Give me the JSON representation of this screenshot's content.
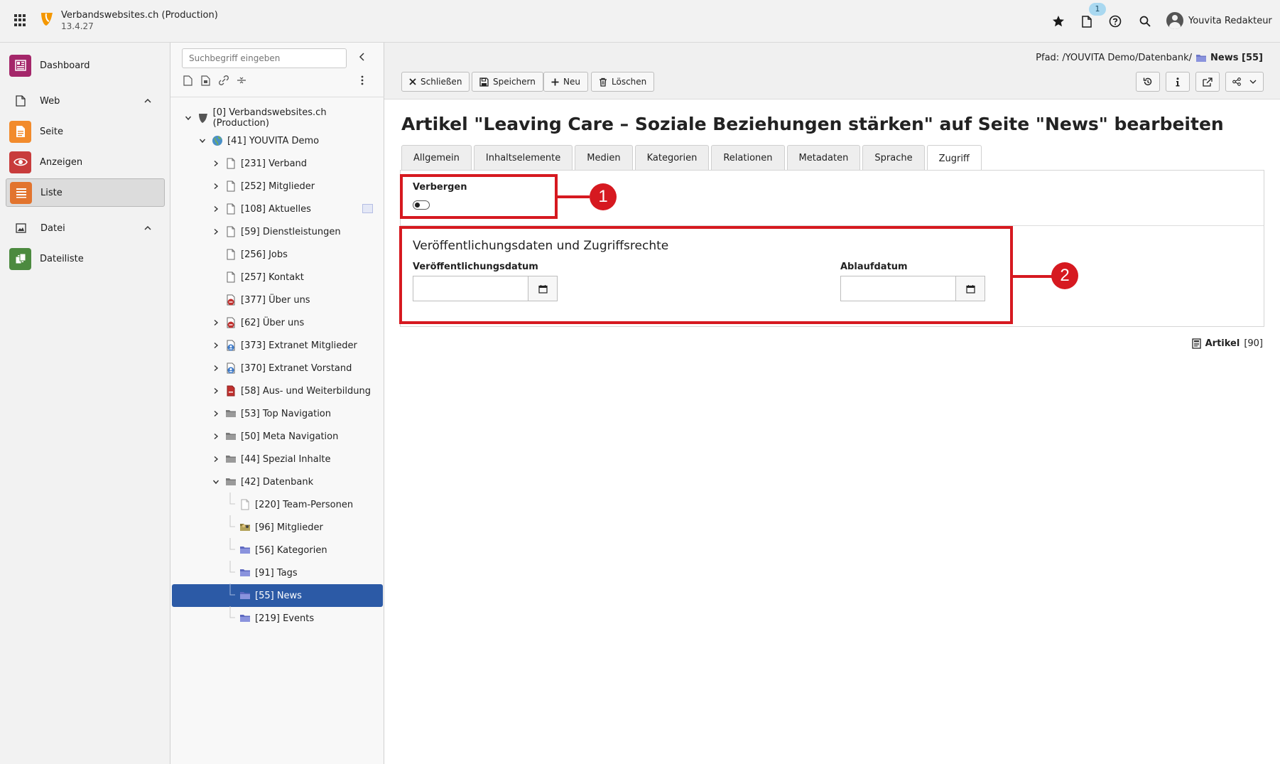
{
  "topbar": {
    "site_name": "Verbandswebsites.ch (Production)",
    "site_version": "13.4.27",
    "notification_count": "1",
    "user_name": "Youvita Redakteur",
    "icons": [
      "apps-grid-icon",
      "typo3-logo-icon",
      "bookmark-star-icon",
      "open-documents-icon",
      "help-icon",
      "search-icon",
      "user-avatar-icon"
    ]
  },
  "modules": {
    "dashboard": "Dashboard",
    "web_group": "Web",
    "page": "Seite",
    "view": "Anzeigen",
    "list": "Liste",
    "file_group": "Datei",
    "filelist": "Dateiliste"
  },
  "tree": {
    "search_placeholder": "Suchbegriff eingeben",
    "nodes": [
      {
        "label": "[0] Verbandswebsites.ch (Production)"
      },
      {
        "label": "[41] YOUVITA Demo"
      },
      {
        "label": "[231] Verband"
      },
      {
        "label": "[252] Mitglieder"
      },
      {
        "label": "[108] Aktuelles"
      },
      {
        "label": "[59] Dienstleistungen"
      },
      {
        "label": "[256] Jobs"
      },
      {
        "label": "[257] Kontakt"
      },
      {
        "label": "[377] Über uns"
      },
      {
        "label": "[62] Über uns"
      },
      {
        "label": "[373] Extranet Mitglieder"
      },
      {
        "label": "[370] Extranet Vorstand"
      },
      {
        "label": "[58] Aus- und Weiterbildung"
      },
      {
        "label": "[53] Top Navigation"
      },
      {
        "label": "[50] Meta Navigation"
      },
      {
        "label": "[44] Spezial Inhalte"
      },
      {
        "label": "[42] Datenbank"
      },
      {
        "label": "[220] Team-Personen"
      },
      {
        "label": "[96] Mitglieder"
      },
      {
        "label": "[56] Kategorien"
      },
      {
        "label": "[91] Tags"
      },
      {
        "label": "[55] News"
      },
      {
        "label": "[219] Events"
      }
    ]
  },
  "docheader": {
    "path_label": "Pfad: /YOUVITA Demo/Datenbank/",
    "path_current": "News [55]",
    "close_label": "Schließen",
    "save_label": "Speichern",
    "new_label": "Neu",
    "delete_label": "Löschen"
  },
  "editor": {
    "title": "Artikel \"Leaving Care – Soziale Beziehungen stärken\" auf Seite \"News\" bearbeiten",
    "tabs": [
      "Allgemein",
      "Inhaltselemente",
      "Medien",
      "Kategorien",
      "Relationen",
      "Metadaten",
      "Sprache",
      "Zugriff"
    ],
    "active_tab": "Zugriff",
    "hide_label": "Verbergen",
    "hide_value": false,
    "palette_title": "Veröffentlichungsdaten und Zugriffsrechte",
    "starttime_label": "Veröffentlichungsdatum",
    "starttime_value": "",
    "endtime_label": "Ablaufdatum",
    "endtime_value": "",
    "record_type": "Artikel",
    "record_uid": "[90]"
  },
  "annotations": {
    "marker_1": "1",
    "marker_2": "2",
    "color": "#d61920"
  },
  "colors": {
    "selected_node": "#2c5aa6",
    "typo3_orange": "#f49700",
    "dashboard_icon": "#a4276a",
    "page_icon": "#f28b2c",
    "view_icon": "#c83c3c",
    "list_icon": "#e2742e",
    "filelist_icon": "#4c8a3f"
  }
}
